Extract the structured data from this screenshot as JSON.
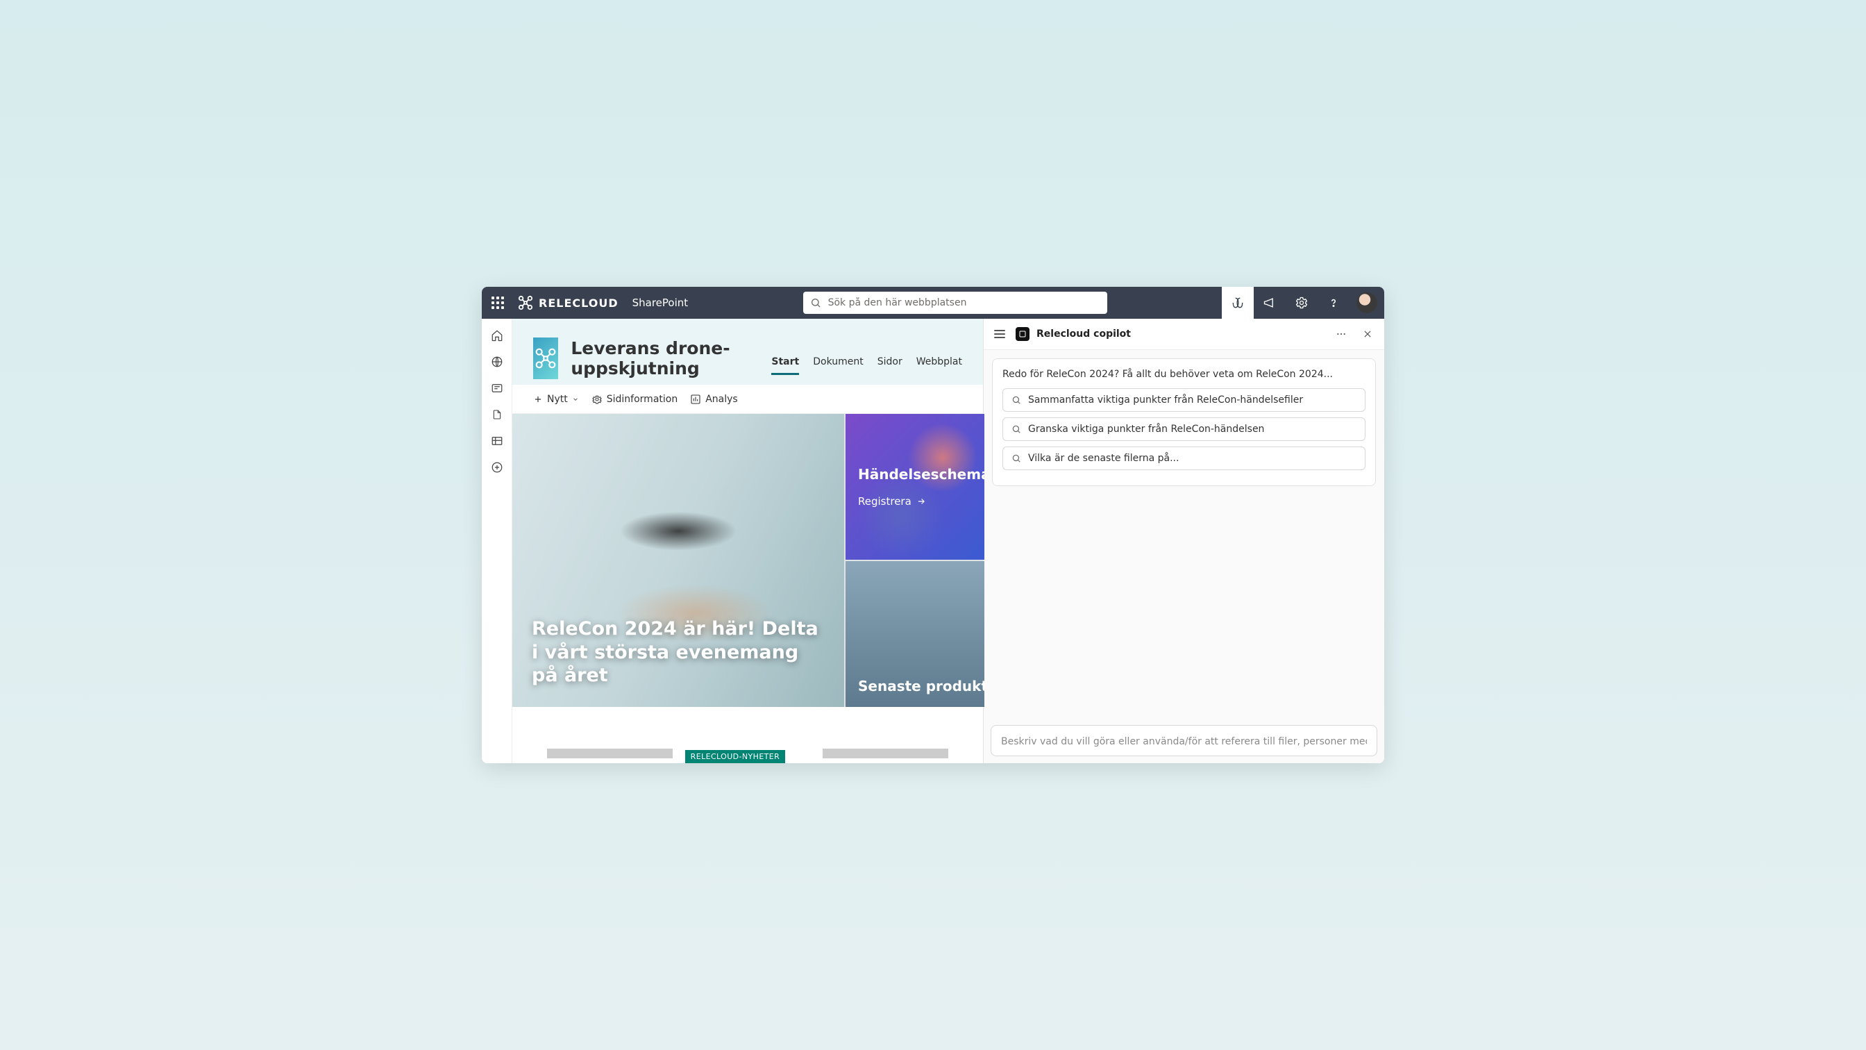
{
  "header": {
    "brand": "RELECLOUD",
    "app": "SharePoint",
    "search_placeholder": "Sök på den här webbplatsen"
  },
  "site": {
    "title": "Leverans drone-uppskjutning",
    "nav": [
      {
        "label": "Start",
        "active": true
      },
      {
        "label": "Dokument",
        "active": false
      },
      {
        "label": "Sidor",
        "active": false
      },
      {
        "label": "Webbplat",
        "active": false
      }
    ]
  },
  "toolbar": {
    "new_label": "Nytt",
    "pageinfo_label": "Sidinformation",
    "analytics_label": "Analys"
  },
  "hero": {
    "main_title": "ReleCon 2024 är här! Delta i vårt största evenemang på året",
    "tile_top_title": "Händelseschema oc",
    "tile_top_link": "Registrera",
    "tile_bottom_title": "Senaste produktmeddelanden"
  },
  "news": {
    "tag": "RELECLOUD-NYHETER"
  },
  "copilot": {
    "title": "Relecloud copilot",
    "intro": "Redo för ReleCon 2024? Få allt du behöver veta om ReleCon 2024...",
    "suggestions": [
      "Sammanfatta viktiga punkter från ReleCon-händelsefiler",
      "Granska viktiga punkter från ReleCon-händelsen",
      "Vilka är de senaste filerna på..."
    ],
    "input_placeholder": "Beskriv vad du vill göra eller använda/för att referera till filer, personer med mera"
  }
}
